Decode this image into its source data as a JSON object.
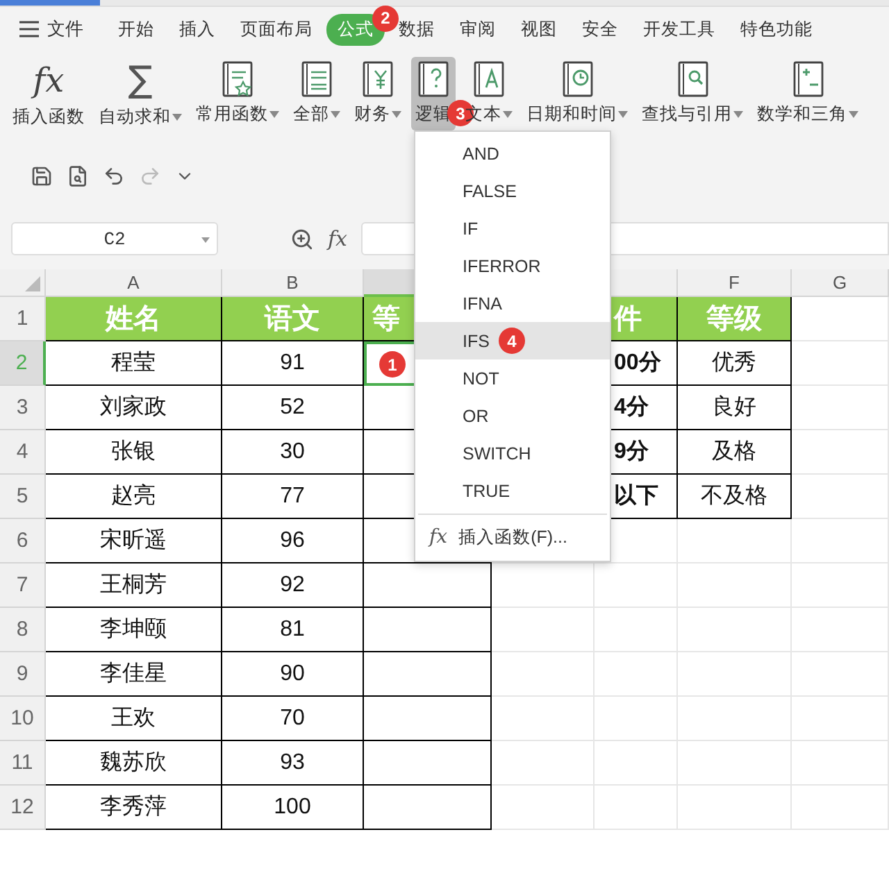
{
  "menu_bar": {
    "menu_label": "文件",
    "tabs": [
      {
        "label": "开始",
        "selected": false
      },
      {
        "label": "插入",
        "selected": false
      },
      {
        "label": "页面布局",
        "selected": false
      },
      {
        "label": "公式",
        "selected": true,
        "badge": "2"
      },
      {
        "label": "数据",
        "selected": false
      },
      {
        "label": "审阅",
        "selected": false
      },
      {
        "label": "视图",
        "selected": false
      },
      {
        "label": "安全",
        "selected": false
      },
      {
        "label": "开发工具",
        "selected": false
      },
      {
        "label": "特色功能",
        "selected": false
      }
    ]
  },
  "ribbon": [
    {
      "label": "插入函数",
      "kind": "glyph",
      "glyph": "fx",
      "dropdown": false,
      "selected": false
    },
    {
      "label": "自动求和",
      "kind": "glyph",
      "glyph": "∑",
      "dropdown": true,
      "selected": false
    },
    {
      "label": "常用函数",
      "kind": "star",
      "dropdown": true,
      "selected": false
    },
    {
      "label": "全部",
      "kind": "lines",
      "dropdown": true,
      "selected": false
    },
    {
      "label": "财务",
      "kind": "yen",
      "dropdown": true,
      "selected": false
    },
    {
      "label": "逻辑",
      "kind": "question",
      "dropdown": false,
      "selected": true,
      "badge": "3"
    },
    {
      "label": "文本",
      "kind": "letter",
      "dropdown": true,
      "selected": false
    },
    {
      "label": "日期和时间",
      "kind": "clock",
      "dropdown": true,
      "selected": false
    },
    {
      "label": "查找与引用",
      "kind": "search",
      "dropdown": true,
      "selected": false
    },
    {
      "label": "数学和三角",
      "kind": "plusminus",
      "dropdown": true,
      "selected": false
    }
  ],
  "formula_bar": {
    "name_box": "C2",
    "fx": "fx"
  },
  "columns": [
    {
      "label": "A",
      "selected": false
    },
    {
      "label": "B",
      "selected": false
    },
    {
      "selected": true
    },
    {},
    {
      "selected": false
    },
    {
      "label": "F",
      "selected": false
    },
    {
      "label": "G",
      "selected": false
    }
  ],
  "rows": [
    {
      "number": "1",
      "kind": "header",
      "selected": false,
      "cells": {
        "column_1": "姓名",
        "column_2": "语文",
        "column_3": "等",
        "column_5": "件",
        "column_6": "等级"
      }
    },
    {
      "number": "2",
      "kind": "full",
      "selected": true,
      "cells": {
        "column_1": "程莹",
        "column_2": "91",
        "column_3": {
          "selected": true,
          "badge": "1"
        },
        "column_5": "00分",
        "column_6": "优秀"
      }
    },
    {
      "number": "3",
      "kind": "full",
      "selected": false,
      "cells": {
        "column_1": "刘家政",
        "column_2": "52",
        "column_5": "4分",
        "column_6": "良好"
      }
    },
    {
      "number": "4",
      "kind": "full",
      "selected": false,
      "cells": {
        "column_1": "张银",
        "column_2": "30",
        "column_5": "9分",
        "column_6": "及格"
      }
    },
    {
      "number": "5",
      "kind": "full",
      "selected": false,
      "cells": {
        "column_1": "赵亮",
        "column_2": "77",
        "column_5": "以下",
        "column_6": "不及格"
      }
    },
    {
      "number": "6",
      "kind": "short",
      "selected": false,
      "cells": {
        "column_1": "宋昕遥",
        "column_2": "96"
      }
    },
    {
      "number": "7",
      "kind": "short",
      "selected": false,
      "cells": {
        "column_1": "王桐芳",
        "column_2": "92"
      }
    },
    {
      "number": "8",
      "kind": "short",
      "selected": false,
      "cells": {
        "column_1": "李坤颐",
        "column_2": "81"
      }
    },
    {
      "number": "9",
      "kind": "short",
      "selected": false,
      "cells": {
        "column_1": "李佳星",
        "column_2": "90"
      }
    },
    {
      "number": "10",
      "kind": "short",
      "selected": false,
      "cells": {
        "column_1": "王欢",
        "column_2": "70"
      }
    },
    {
      "number": "11",
      "kind": "short",
      "selected": false,
      "cells": {
        "column_1": "魏苏欣",
        "column_2": "93"
      }
    },
    {
      "number": "12",
      "kind": "short",
      "selected": false,
      "cells": {
        "column_1": "李秀萍",
        "column_2": "100"
      }
    }
  ],
  "dropdown_menu": {
    "items": [
      {
        "label": "AND",
        "selected": false
      },
      {
        "label": "FALSE",
        "selected": false
      },
      {
        "label": "IF",
        "selected": false
      },
      {
        "label": "IFERROR",
        "selected": false
      },
      {
        "label": "IFNA",
        "selected": false
      },
      {
        "label": "IFS",
        "selected": true,
        "badge": "4"
      },
      {
        "label": "NOT",
        "selected": false
      },
      {
        "label": "OR",
        "selected": false
      },
      {
        "label": "SWITCH",
        "selected": false
      },
      {
        "label": "TRUE",
        "selected": false
      }
    ],
    "footer": {
      "glyph": "fx",
      "label": "插入函数(F)..."
    }
  }
}
